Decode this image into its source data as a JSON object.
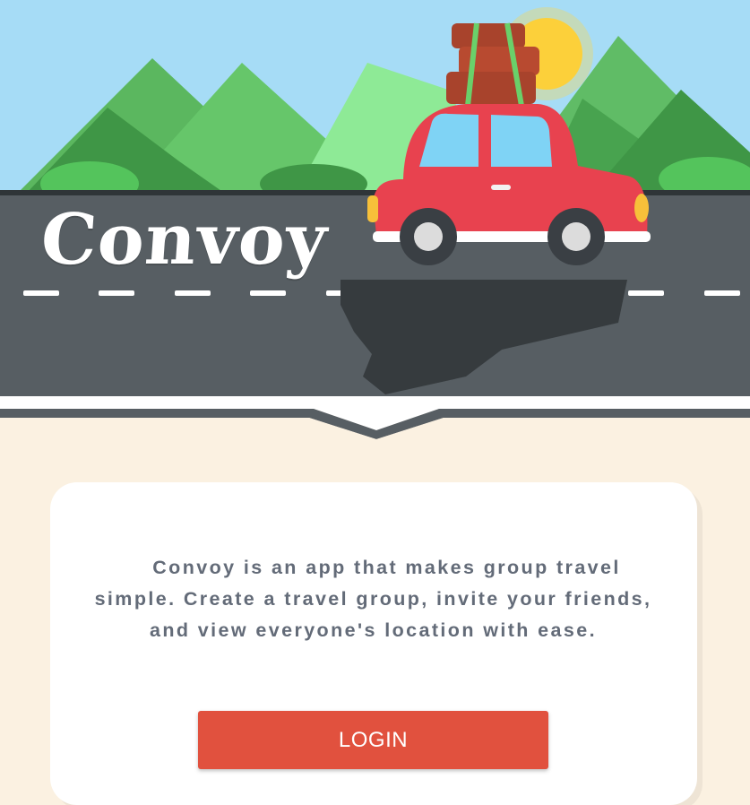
{
  "app": {
    "title": "Convoy",
    "description": "Convoy is an app that makes group travel simple. Create a travel group, invite your friends, and view everyone's location with ease."
  },
  "login_button": {
    "label": "LOGIN"
  },
  "colors": {
    "sky": "#a6dcf6",
    "road": "#575e63",
    "page_background": "#fbf1e1",
    "card": "#ffffff",
    "button": "#e1513e",
    "car": "#e8424f",
    "text": "#636b78"
  },
  "icons": [
    "car-illustration",
    "luggage-icon",
    "sun-icon",
    "mountains-illustration"
  ]
}
